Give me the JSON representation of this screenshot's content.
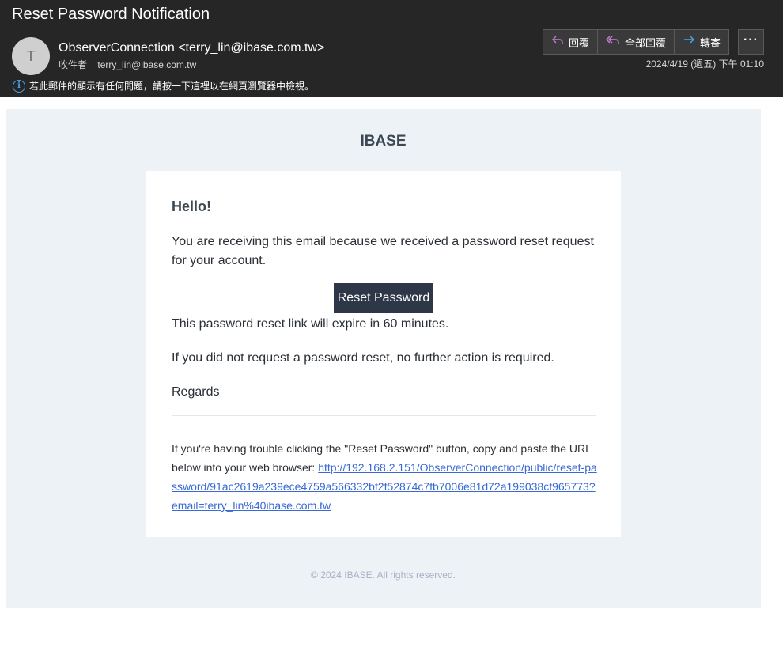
{
  "email": {
    "subject": "Reset Password Notification",
    "avatar_initial": "T",
    "from": "ObserverConnection <terry_lin@ibase.com.tw>",
    "to_label": "收件者",
    "to_address": "terry_lin@ibase.com.tw",
    "info_text": "若此郵件的顯示有任何問題，請按一下這裡以在網頁瀏覽器中檢視。",
    "datetime": "2024/4/19 (週五) 下午 01:10"
  },
  "actions": {
    "reply": "回覆",
    "reply_all": "全部回覆",
    "forward": "轉寄",
    "more": "···"
  },
  "icons": {
    "info": "info-icon",
    "reply": "reply-icon",
    "reply_all": "reply-all-icon",
    "forward": "forward-icon",
    "more": "more-icon"
  },
  "colors": {
    "header_bg": "#262626",
    "body_bg": "#edf2f7",
    "button_bg": "#2d3748",
    "link": "#3869d4",
    "reply_icon": "#c77dd8",
    "forward_icon": "#4aa3e8"
  },
  "message": {
    "brand": "IBASE",
    "greeting": "Hello!",
    "line1": "You are receiving this email because we received a password reset request for your account.",
    "button_label": "Reset Password",
    "line2": "This password reset link will expire in 60 minutes.",
    "line3": "If you did not request a password reset, no further action is required.",
    "regards": "Regards",
    "trouble_text": "If you're having trouble clicking the \"Reset Password\" button, copy and paste the URL below into your web browser: ",
    "reset_url": "http://192.168.2.151/ObserverConnection/public/reset-password/91ac2619a239ece4759a566332bf2f52874c7fb7006e81d72a199038cf965773?email=terry_lin%40ibase.com.tw",
    "footer": "© 2024 IBASE. All rights reserved."
  }
}
